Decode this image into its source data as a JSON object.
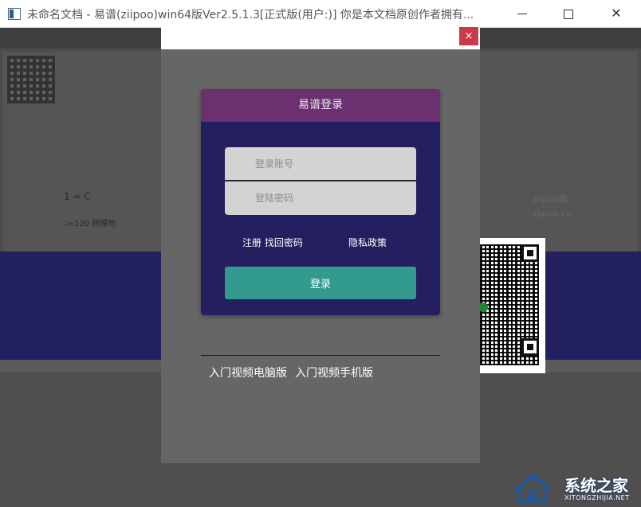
{
  "window": {
    "title": "未命名文档 - 易谱(ziipoo)win64版Ver2.5.1.3[正式版(用户:)] 你是本文档原创作者拥有...",
    "controls": {
      "minimize": "—",
      "maximize": "",
      "close": "✕"
    }
  },
  "background": {
    "score_mark": "1 = C",
    "tempo": "♩=120 稍慢地",
    "watermark_line1": "ziipoo网",
    "watermark_line2": "ziipoo.cn"
  },
  "modal": {
    "close_label": "×",
    "login": {
      "title": "易谱登录",
      "account_placeholder": "登录账号",
      "password_placeholder": "登陆密码",
      "register_link": "注册 找回密码",
      "privacy_link": "隐私政策",
      "login_button": "登录"
    },
    "video_links": [
      "入门视频电脑版",
      "入门视频手机版"
    ]
  },
  "watermark": {
    "title": "系统之家",
    "subtitle": "XITONGZHIJIA.NET"
  },
  "colors": {
    "login_header": "#6a3070",
    "login_card": "#241f5f",
    "login_button": "#339a8e",
    "close_button": "#cc3a4a"
  }
}
